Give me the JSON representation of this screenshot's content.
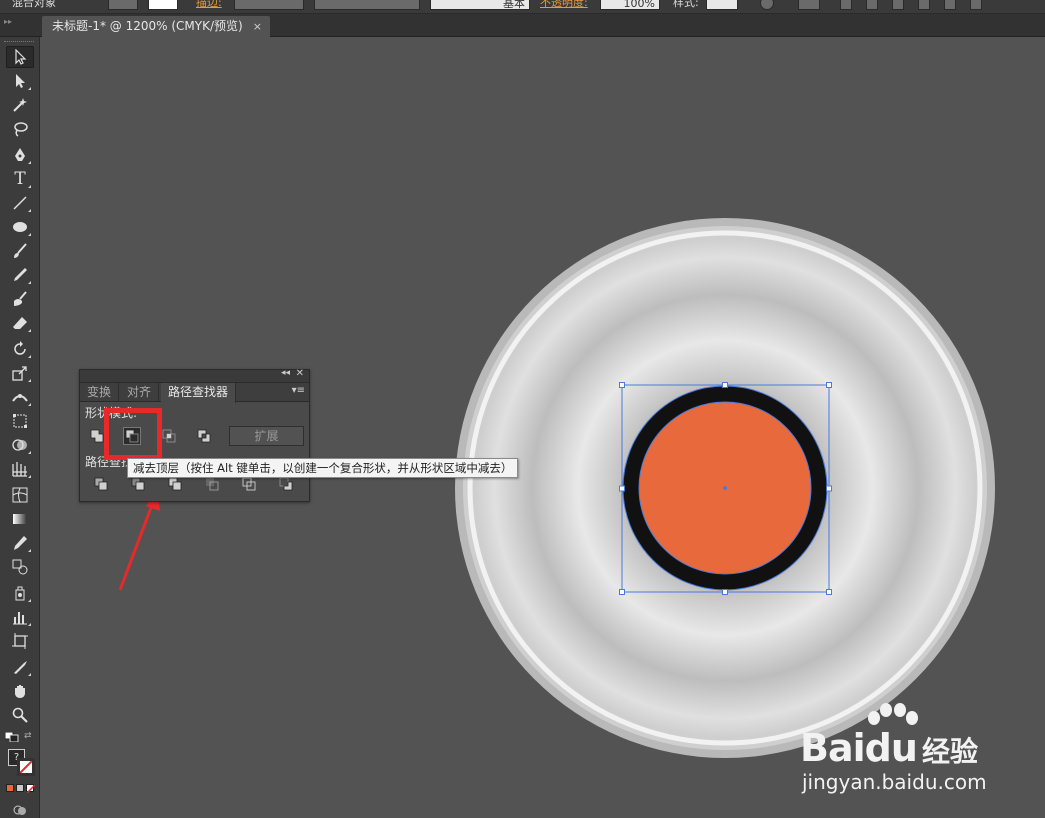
{
  "control_bar": {
    "mix_label": "混合对象",
    "stroke_label": "描边:",
    "brush_value": "基本",
    "opacity_label": "不透明度:",
    "opacity_value": "100%",
    "style_label": "样式:"
  },
  "document_tab": {
    "title": "未标题-1* @ 1200% (CMYK/预览)",
    "close": "×"
  },
  "toolbox": {
    "tools": [
      "selection-tool",
      "direct-selection-tool",
      "magic-wand-tool",
      "lasso-tool",
      "pen-tool",
      "type-tool",
      "line-tool",
      "ellipse-tool",
      "paintbrush-tool",
      "pencil-tool",
      "blob-brush-tool",
      "eraser-tool",
      "rotate-tool",
      "scale-tool",
      "width-tool",
      "free-transform-tool",
      "shape-builder-tool",
      "perspective-grid-tool",
      "mesh-tool",
      "gradient-tool",
      "eyedropper-tool",
      "blend-tool",
      "symbol-sprayer-tool",
      "column-graph-tool",
      "artboard-tool",
      "slice-tool",
      "hand-tool",
      "zoom-tool"
    ],
    "type_glyph": "T",
    "fill_stroke_swap": "?"
  },
  "panel": {
    "tabs": [
      "变换",
      "对齐",
      "路径查找器"
    ],
    "active_tab": "路径查找器",
    "shape_modes_label": "形状模式:",
    "pathfinders_label": "路径查找器:",
    "expand_label": "扩展",
    "collapse_glyph": "◂◂",
    "close_glyph": "✕",
    "menu_glyph": "▾≡"
  },
  "tooltip": {
    "text": "减去顶层（按住 Alt 键单击，以创建一个复合形状，并从形状区域中减去）"
  },
  "artwork": {
    "inner_fill": "#e86a3c",
    "ring_color": "#111111",
    "selection_color": "#4a7bdc",
    "annotation_color": "#e8292a"
  },
  "watermark": {
    "logo_bai": "Bai",
    "logo_du": "du",
    "logo_cn": "经验",
    "url": "jingyan.baidu.com"
  }
}
